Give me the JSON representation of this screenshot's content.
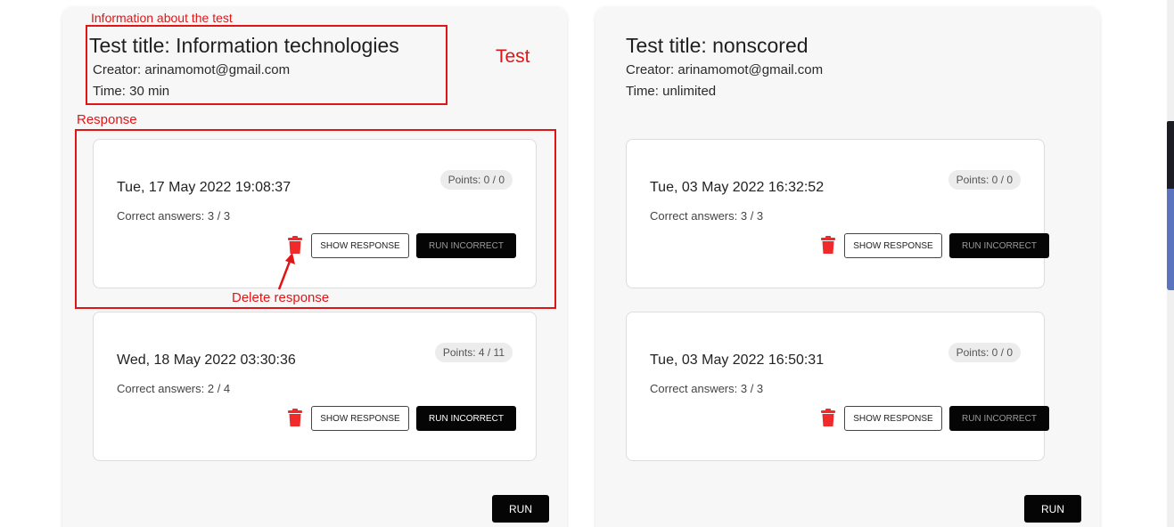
{
  "annotations": {
    "info_label": "Information about the test",
    "test_label": "Test",
    "response_label": "Response",
    "delete_label": "Delete response",
    "color": "#e01616"
  },
  "tests": [
    {
      "title": "Test title: Information technologies",
      "creator": "Creator: arinamomot@gmail.com",
      "time": "Time: 30 min",
      "responses": [
        {
          "date": "Tue, 17 May 2022 19:08:37",
          "correct": "Correct answers: 3 / 3",
          "points": "Points: 0 / 0",
          "show_label": "SHOW RESPONSE",
          "run_incorrect_label": "RUN INCORRECT",
          "run_incorrect_enabled": false
        },
        {
          "date": "Wed, 18 May 2022 03:30:36",
          "correct": "Correct answers: 2 / 4",
          "points": "Points: 4 / 11",
          "show_label": "SHOW RESPONSE",
          "run_incorrect_label": "RUN INCORRECT",
          "run_incorrect_enabled": true
        }
      ],
      "run_label": "RUN"
    },
    {
      "title": "Test title: nonscored",
      "creator": "Creator: arinamomot@gmail.com",
      "time": "Time: unlimited",
      "responses": [
        {
          "date": "Tue, 03 May 2022 16:32:52",
          "correct": "Correct answers: 3 / 3",
          "points": "Points: 0 / 0",
          "show_label": "SHOW RESPONSE",
          "run_incorrect_label": "RUN INCORRECT",
          "run_incorrect_enabled": false
        },
        {
          "date": "Tue, 03 May 2022 16:50:31",
          "correct": "Correct answers: 3 / 3",
          "points": "Points: 0 / 0",
          "show_label": "SHOW RESPONSE",
          "run_incorrect_label": "RUN INCORRECT",
          "run_incorrect_enabled": false
        }
      ],
      "run_label": "RUN"
    }
  ],
  "icons": {
    "delete": "trash-icon",
    "delete_color": "#f02a2a"
  }
}
